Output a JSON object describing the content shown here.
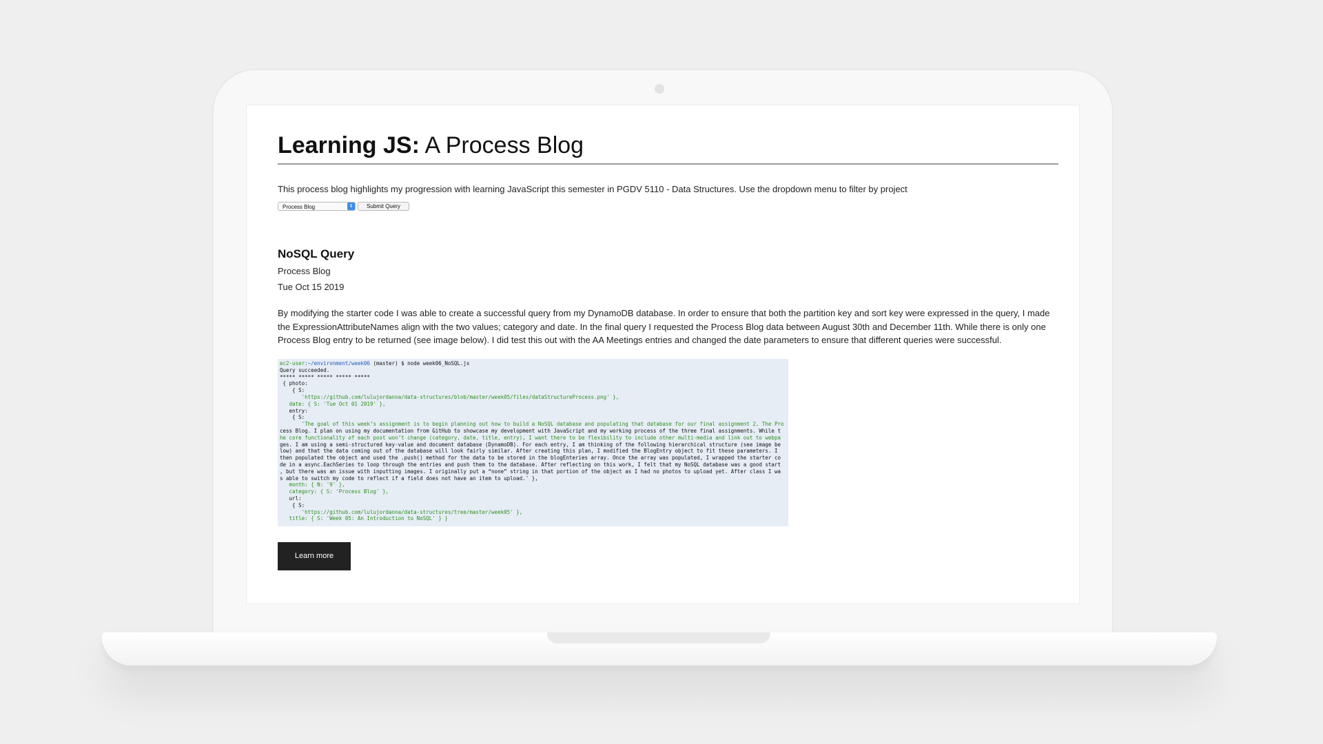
{
  "blog": {
    "title_bold": "Learning JS:",
    "title_rest": " A Process Blog",
    "intro": "This process blog highlights my progression with learning JavaScript this semester in PGDV 5110 - Data Structures. Use the dropdown menu to filter by project"
  },
  "filter": {
    "selected": "Process Blog",
    "submit_label": "Submit Query"
  },
  "post": {
    "title": "NoSQL Query",
    "category": "Process Blog",
    "date": "Tue Oct 15 2019",
    "body": "By modifying the starter code I was able to create a successful query from my DynamoDB database. In order to ensure that both the partition key and sort key were expressed in the query, I made the ExpressionAttributeNames align with the two values; category and date. In the final query I requested the Process Blog data between August 30th and December 11th. While there is only one Process Blog entry to be returned (see image below). I did test this out with the AA Meetings entries and changed the date parameters to ensure that different queries were successful.",
    "learn_more_label": "Learn more"
  },
  "terminal": {
    "prompt_user": "ec2-user",
    "prompt_path": ":~/environment/week06",
    "prompt_cmd": " (master) $ node week06_NoSQL.js",
    "lines": [
      "Query succeeded.",
      "***** ***** ***** ***** *****",
      " { photo:",
      "    { S:",
      "       'https://github.com/lulujordanna/data-structures/blob/master/week05/files/dataStructureProcess.png' },",
      "   date: { S: 'Tue Oct 01 2019' },",
      "   entry:",
      "    { S:",
      "       'The goal of this week’s assignment is to begin planning out how to build a NoSQL database and populating that database for our final assignment 2, The Pro",
      "cess Blog. I plan on using my documentation from GitHub to showcase my development with JavaScript and my working process of the three final assignments. While t",
      "he core functionality of each post won’t change (category, date, title, entry), I want there to be flexibility to include other multi-media and link out to webpa",
      "ges. I am using a semi-structured key-value and document database (DynamoDB). For each entry, I am thinking of the following hierarchical structure (see image be",
      "low) and that the data coming out of the database will look fairly similar. After creating this plan, I modified the BlogEntry object to fit these parameters. I",
      "then populated the object and used the .push() method for the data to be stored in the blogEnteries array. Once the array was populated, I wrapped the starter co",
      "de in a async.EachSeries to loop through the entries and push them to the database. After reflecting on this work, I felt that my NoSQL database was a good start",
      ", but there was an issue with inputting images. I originally put a “none” string in that portion of the object as I had no photos to upload yet. After class I wa",
      "s able to switch my code to reflect if a field does not have an item to upload.' },",
      "   month: { N: '9' },",
      "   category: { S: 'Process Blog' },",
      "   url:",
      "    { S:",
      "       'https://github.com/lulujordanna/data-structures/tree/master/week05' },",
      "   title: { S: 'Week 05: An Introduction to NoSQL' } }"
    ]
  }
}
